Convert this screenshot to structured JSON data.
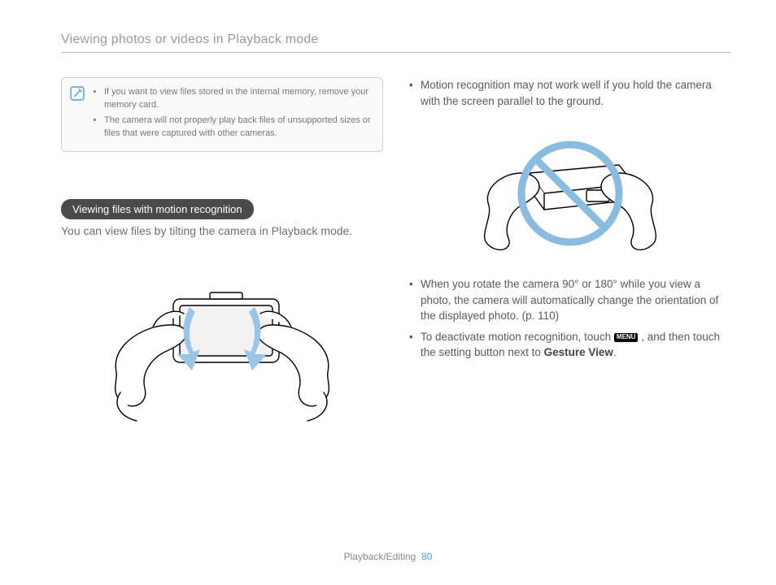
{
  "header": "Viewing photos or videos in Playback mode",
  "note": {
    "items": [
      "If you want to view files stored in the internal memory, remove your memory card.",
      "The camera will not properly play back files of unsupported sizes or files that were captured with other cameras."
    ]
  },
  "section": {
    "pill": "Viewing files with motion recognition",
    "desc": "You can view files by tilting the camera in Playback mode."
  },
  "rightCol": {
    "motionWarn": "Motion recognition may not work well if you hold the camera with the screen parallel to the ground.",
    "rotateNote": "When you rotate the camera 90° or 180° while you view a photo, the camera will automatically change the orientation of the displayed photo. (p. 110)",
    "deactivate_a": "To deactivate motion recognition, touch ",
    "deactivate_menu": "MENU",
    "deactivate_b": ", and then touch the setting button next to ",
    "deactivate_strong": "Gesture View",
    "deactivate_c": "."
  },
  "footer": {
    "section": "Playback/Editing",
    "page": "80"
  }
}
